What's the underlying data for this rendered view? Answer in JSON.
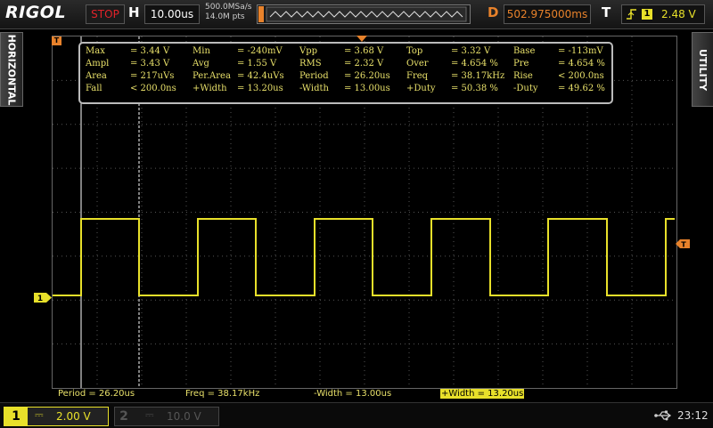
{
  "header": {
    "logo": "RIGOL",
    "run_status": "STOP",
    "horizontal_label": "H",
    "timebase": "10.00us",
    "sample_rate": "500.0MSa/s",
    "memory_depth": "14.0M pts",
    "delay_label": "D",
    "delay": "502.975000ms",
    "trigger_label": "T",
    "trigger_source": "1",
    "trigger_level": "2.48 V",
    "trigger_edge_icon": "rising-edge-icon"
  },
  "side_tabs": {
    "left": "HORIZONTAL",
    "right": "UTILITY"
  },
  "measurements": [
    [
      [
        "Max",
        "= 3.44 V"
      ],
      [
        "Min",
        "= -240mV"
      ],
      [
        "Vpp",
        "= 3.68 V"
      ],
      [
        "Top",
        "= 3.32 V"
      ],
      [
        "Base",
        "= -113mV"
      ]
    ],
    [
      [
        "Ampl",
        "= 3.43 V"
      ],
      [
        "Avg",
        "= 1.55 V"
      ],
      [
        "RMS",
        "= 2.32 V"
      ],
      [
        "Over",
        "= 4.654 %"
      ],
      [
        "Pre",
        "= 4.654 %"
      ]
    ],
    [
      [
        "Area",
        "= 217uVs"
      ],
      [
        "Per.Area",
        "= 42.4uVs"
      ],
      [
        "Period",
        "= 26.20us"
      ],
      [
        "Freq",
        "= 38.17kHz"
      ],
      [
        "Rise",
        "< 200.0ns"
      ]
    ],
    [
      [
        "Fall",
        "< 200.0ns"
      ],
      [
        "+Width",
        "= 13.20us"
      ],
      [
        "-Width",
        "= 13.00us"
      ],
      [
        "+Duty",
        "= 50.38 %"
      ],
      [
        "-Duty",
        "= 49.62 %"
      ]
    ]
  ],
  "bottom_measurements": {
    "period": "Period = 26.20us",
    "freq": "Freq = 38.17kHz",
    "neg_width": "-Width = 13.00us",
    "pos_width": "+Width = 13.20us"
  },
  "channels": {
    "ch1": {
      "number": "1",
      "coupling": "⎓",
      "scale": "2.00 V",
      "color": "#e8e02a"
    },
    "ch2": {
      "number": "2",
      "coupling": "⎓",
      "scale": "10.0 V",
      "color": "#555555"
    }
  },
  "markers": {
    "ch1_ground": "1",
    "trigger_pos": "T",
    "trigger_level": "T"
  },
  "status": {
    "usb_icon": "usb-icon",
    "time": "23:12"
  }
}
